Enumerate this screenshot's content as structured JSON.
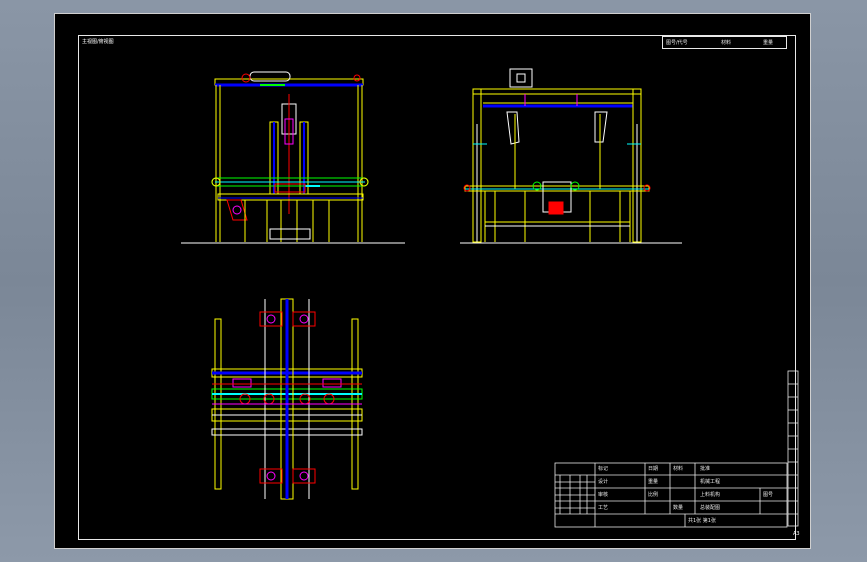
{
  "drawing": {
    "note_top_left": "主视图/俯视图",
    "sheet_code": "A3"
  },
  "header_box": {
    "cells": [
      "图号/代号",
      "材料",
      "重量"
    ]
  },
  "title_block": {
    "labels": [
      "标记",
      "设计",
      "审核",
      "工艺",
      "批准"
    ],
    "values": [
      "日期",
      "重量",
      "比例",
      "材料",
      "数量"
    ],
    "title": "总装配图",
    "company": "机械工程",
    "part_name": "上料机构",
    "drawing_no": "图号",
    "sheet": "共1张 第1张"
  },
  "colors": {
    "frame": "#ffff00",
    "beam": "#0000ff",
    "accent": "#ff0000",
    "detail_green": "#00ff00",
    "detail_cyan": "#00ffff",
    "detail_magenta": "#ff00ff",
    "outline": "#ffffff"
  }
}
